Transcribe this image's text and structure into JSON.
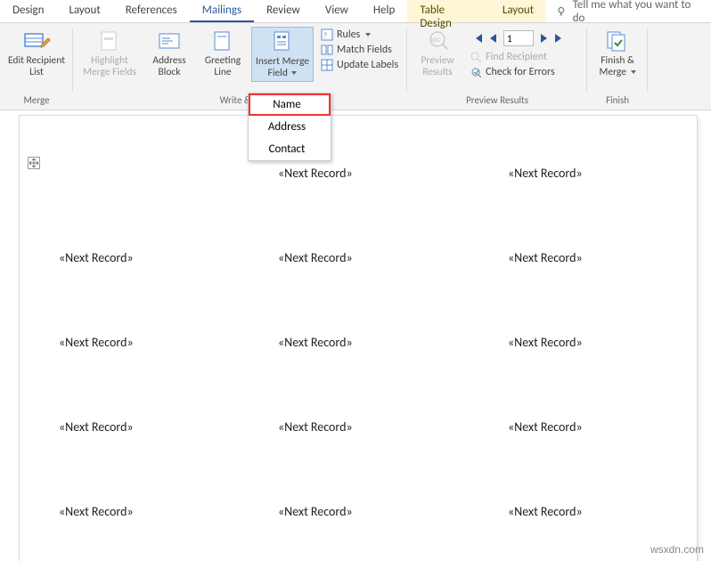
{
  "tabs": {
    "design": "Design",
    "layout1": "Layout",
    "references": "References",
    "mailings": "Mailings",
    "review": "Review",
    "view": "View",
    "help": "Help",
    "table_design": "Table Design",
    "layout2": "Layout",
    "tellme": "Tell me what you want to do"
  },
  "ribbon": {
    "edit_recipient": "Edit Recipient List",
    "merge_group": "Merge",
    "highlight": "Highlight Merge Fields",
    "address": "Address Block",
    "greeting": "Greeting Line",
    "insert_merge": "Insert Merge Field",
    "rules": "Rules",
    "match": "Match Fields",
    "update": "Update Labels",
    "write_group": "Write & In",
    "preview": "Preview Results",
    "find": "Find Recipient",
    "check": "Check for Errors",
    "preview_group": "Preview Results",
    "record_value": "1",
    "finish": "Finish & Merge",
    "finish_group": "Finish"
  },
  "dropdown": {
    "name": "Name",
    "address": "Address",
    "contact": "Contact"
  },
  "doc": {
    "next_record": "«Next Record»"
  },
  "watermark": "wsxdn.com"
}
